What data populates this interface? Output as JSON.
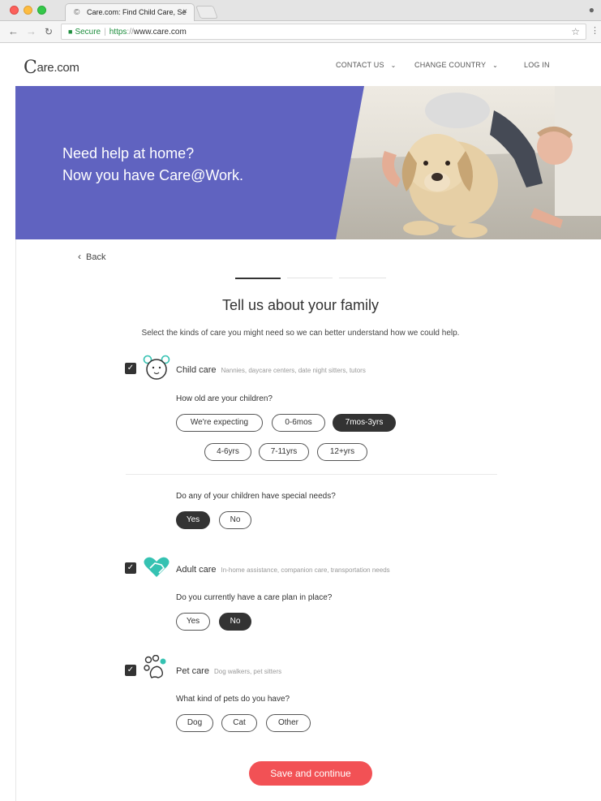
{
  "browser": {
    "tab_title": "Care.com: Find Child Care, Se",
    "tab_close": "×",
    "url_secure_label": "Secure",
    "url_scheme": "https",
    "url_slashes": "://",
    "url_host": "www.care.com"
  },
  "header": {
    "logo_prefix": "C",
    "logo_text": "are.com",
    "nav": [
      {
        "label": "CONTACT US"
      },
      {
        "label": "CHANGE COUNTRY"
      },
      {
        "label": "LOG IN"
      }
    ]
  },
  "hero": {
    "line1": "Need help at home?",
    "line2": "Now you have Care@Work."
  },
  "main": {
    "back_label": "Back",
    "title": "Tell us about your family",
    "subtitle": "Select the kinds of care you might need so we can better understand how we could help."
  },
  "child_care": {
    "name": "Child care",
    "desc": "Nannies, daycare centers, date night sitters, tutors",
    "checked": true,
    "age_question": "How old are your children?",
    "ages": [
      {
        "label": "We're expecting",
        "selected": false
      },
      {
        "label": "0-6mos",
        "selected": false
      },
      {
        "label": "7mos-3yrs",
        "selected": true
      },
      {
        "label": "4-6yrs",
        "selected": false
      },
      {
        "label": "7-11yrs",
        "selected": false
      },
      {
        "label": "12+yrs",
        "selected": false
      }
    ],
    "needs_question": "Do any of your children have special needs?",
    "needs": [
      {
        "label": "Yes",
        "selected": true
      },
      {
        "label": "No",
        "selected": false
      }
    ]
  },
  "adult_care": {
    "name": "Adult care",
    "desc": "In-home assistance, companion care, transportation needs",
    "checked": true,
    "question": "Do you currently have a care plan in place?",
    "options": [
      {
        "label": "Yes",
        "selected": false
      },
      {
        "label": "No",
        "selected": true
      }
    ]
  },
  "pet_care": {
    "name": "Pet care",
    "desc": "Dog walkers, pet sitters",
    "checked": true,
    "question": "What kind of pets do you have?",
    "options": [
      {
        "label": "Dog",
        "selected": false
      },
      {
        "label": "Cat",
        "selected": false
      },
      {
        "label": "Other",
        "selected": false
      }
    ]
  },
  "cta_label": "Save and continue",
  "colors": {
    "hero_purple": "#6468c8",
    "cta_red": "#f25155",
    "icon_teal": "#35c2b2",
    "selected_pill": "#333333"
  }
}
